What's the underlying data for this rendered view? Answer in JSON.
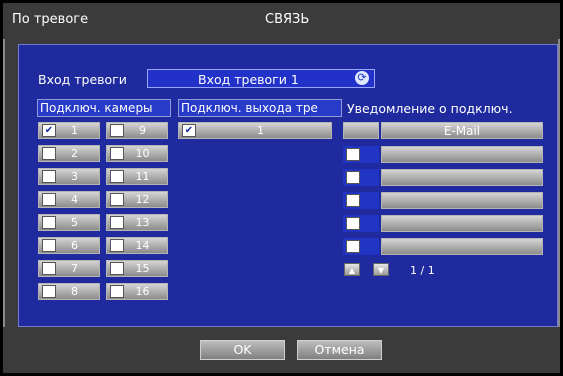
{
  "title": {
    "left": "По тревоге",
    "center": "СВЯЗЬ"
  },
  "alarm_input": {
    "label": "Вход тревоги",
    "value": "Вход тревоги 1",
    "refresh_icon": "refresh-icon"
  },
  "columns": {
    "cameras": "Подключ. камеры",
    "outputs": "Подключ. выхода тре",
    "notify": "Уведомление о подключ."
  },
  "cameras": [
    {
      "num": "1",
      "checked": true
    },
    {
      "num": "9",
      "checked": false
    },
    {
      "num": "2",
      "checked": false
    },
    {
      "num": "10",
      "checked": false
    },
    {
      "num": "3",
      "checked": false
    },
    {
      "num": "11",
      "checked": false
    },
    {
      "num": "4",
      "checked": false
    },
    {
      "num": "12",
      "checked": false
    },
    {
      "num": "5",
      "checked": false
    },
    {
      "num": "13",
      "checked": false
    },
    {
      "num": "6",
      "checked": false
    },
    {
      "num": "14",
      "checked": false
    },
    {
      "num": "7",
      "checked": false
    },
    {
      "num": "15",
      "checked": false
    },
    {
      "num": "8",
      "checked": false
    },
    {
      "num": "16",
      "checked": false
    }
  ],
  "outputs": [
    {
      "num": "1",
      "checked": true
    }
  ],
  "notify": {
    "first": "E-Mail",
    "page": "1 / 1"
  },
  "buttons": {
    "ok": "OK",
    "cancel": "Отмена"
  }
}
